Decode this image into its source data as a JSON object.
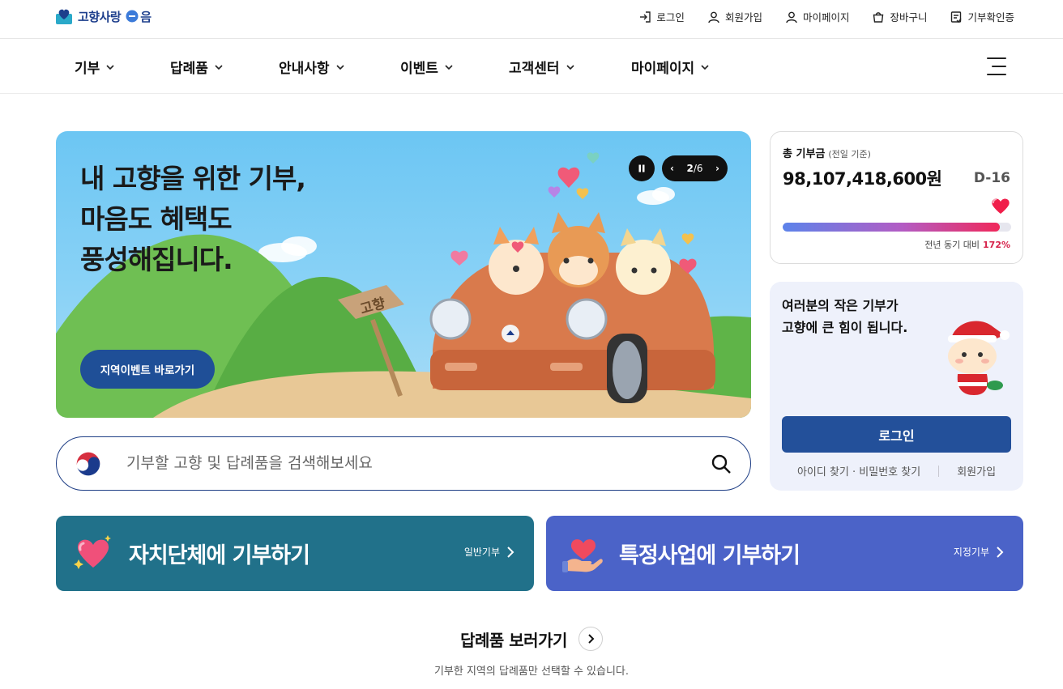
{
  "header": {
    "logo_text": "고향사랑",
    "logo_suffix": "음",
    "util_links": [
      {
        "label": "로그인",
        "icon": "login-icon"
      },
      {
        "label": "회원가입",
        "icon": "user-icon"
      },
      {
        "label": "마이페이지",
        "icon": "user-icon"
      },
      {
        "label": "장바구니",
        "icon": "cart-icon"
      },
      {
        "label": "기부확인증",
        "icon": "certificate-icon"
      }
    ]
  },
  "nav": {
    "items": [
      "기부",
      "답례품",
      "안내사항",
      "이벤트",
      "고객센터",
      "마이페이지"
    ],
    "menu_icon": "hamburger-icon"
  },
  "hero": {
    "title_lines": [
      "내 고향을 위한 기부,",
      "마음도 혜택도",
      "풍성해집니다."
    ],
    "button_label": "지역이벤트 바로가기",
    "sign_text": "고향",
    "pager_current": "2",
    "pager_total": "6",
    "pager_separator": "/"
  },
  "search": {
    "placeholder": "기부할 고향 및 답례품을 검색해보세요",
    "icon": "search-icon"
  },
  "donation": {
    "label": "총 기부금",
    "sublabel": "(전일 기준)",
    "amount": "98,107,418,600원",
    "dday": "D-16",
    "progress_fraction": 0.95,
    "yoy_label": "전년 동기 대비",
    "yoy_value": "172%"
  },
  "login_card": {
    "message_lines": [
      "여러분의 작은 기부가",
      "고향에 큰 힘이 됩니다."
    ],
    "login_button": "로그인",
    "find_links": "아이디 찾기 · 비밀번호 찾기",
    "signup_link": "회원가입"
  },
  "tiles": [
    {
      "title": "자치단체에 기부하기",
      "link": "일반기부",
      "color": "#21718a",
      "icon": "heart-sparkle-icon"
    },
    {
      "title": "특정사업에 기부하기",
      "link": "지정기부",
      "color": "#4b63c8",
      "icon": "hand-heart-icon"
    }
  ],
  "gifts": {
    "title": "답례품 보러가기",
    "subtitle": "기부한 지역의 답례품만 선택할 수 있습니다."
  },
  "colors": {
    "brand_navy": "#1f4f97",
    "accent_red": "#d6224a",
    "tile_teal": "#21718a",
    "tile_blue": "#4b63c8"
  }
}
